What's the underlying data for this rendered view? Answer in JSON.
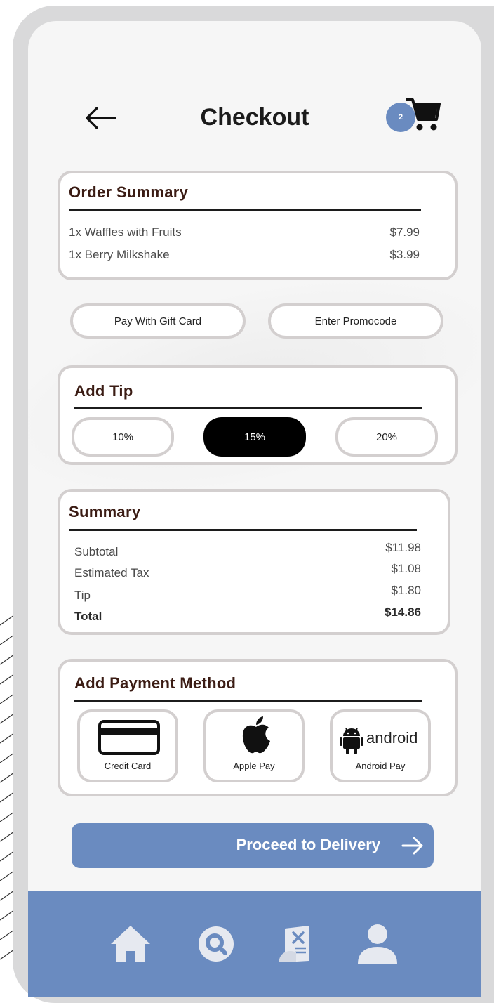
{
  "header": {
    "title": "Checkout",
    "cart_count": "2"
  },
  "order_summary": {
    "title": "Order Summary",
    "items": [
      {
        "name": "1x Waffles with Fruits",
        "price": "$7.99"
      },
      {
        "name": "1x Berry Milkshake",
        "price": "$3.99"
      }
    ]
  },
  "actions": {
    "gift_card": "Pay With Gift Card",
    "promocode": "Enter Promocode"
  },
  "tip": {
    "title": "Add Tip",
    "options": [
      "10%",
      "15%",
      "20%"
    ],
    "selected": "15%"
  },
  "summary": {
    "title": "Summary",
    "rows": [
      {
        "label": "Subtotal",
        "value": "$11.98"
      },
      {
        "label": "Estimated Tax",
        "value": "$1.08"
      },
      {
        "label": "Tip",
        "value": "$1.80"
      },
      {
        "label": "Total",
        "value": "$14.86"
      }
    ]
  },
  "payment": {
    "title": "Add Payment Method",
    "methods": [
      {
        "label": "Credit Card",
        "icon": "credit-card-icon"
      },
      {
        "label": "Apple Pay",
        "icon": "apple-icon"
      },
      {
        "label": "Android Pay",
        "icon": "android-icon",
        "logo_text": "android"
      }
    ]
  },
  "proceed": {
    "label": "Proceed to Delivery"
  },
  "nav": {
    "items": [
      "home-icon",
      "search-icon",
      "menu-icon",
      "profile-icon"
    ]
  },
  "colors": {
    "accent": "#6a8bc0",
    "card_border": "#d3cfcf",
    "heading": "#3b1c14",
    "selected_tip": "#000000"
  }
}
